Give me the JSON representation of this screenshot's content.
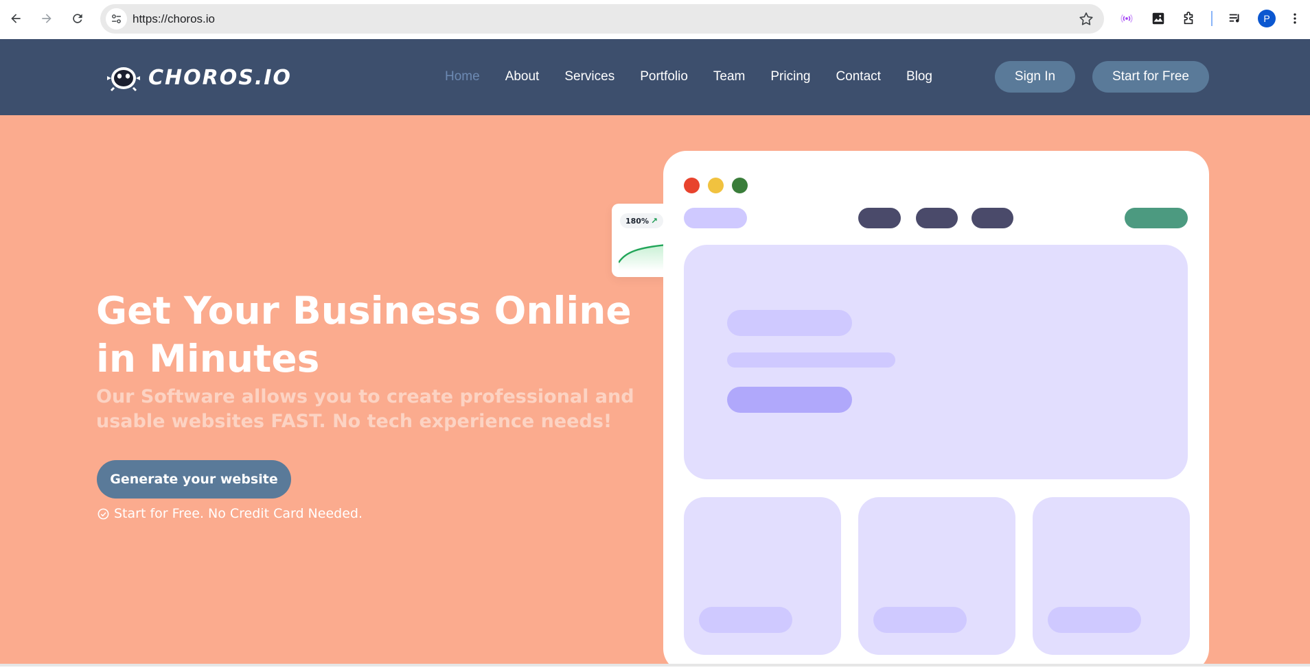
{
  "browser": {
    "url": "https://choros.io",
    "profile_initial": "P",
    "icons": [
      "back-icon",
      "forward-icon",
      "reload-icon",
      "site-settings-icon",
      "bookmark-star-icon",
      "broadcast-icon",
      "image-capture-icon",
      "extensions-puzzle-icon",
      "reading-list-icon",
      "profile-avatar",
      "more-menu-icon"
    ]
  },
  "header": {
    "brand": "CHOROS.IO",
    "nav": [
      "Home",
      "About",
      "Services",
      "Portfolio",
      "Team",
      "Pricing",
      "Contact",
      "Blog"
    ],
    "active_nav": "Home",
    "sign_in": "Sign In",
    "start_free": "Start for Free"
  },
  "hero": {
    "title": "Get Your Business Online in Minutes",
    "subtitle": "Our Software allows you to create professional and usable websites FAST. No tech experience needs!",
    "cta": "Generate your website",
    "note": "Start for Free. No Credit Card Needed."
  },
  "illustration": {
    "stat_badge": "180%",
    "colors": {
      "dot_red": "#e8432d",
      "dot_yellow": "#f1c23f",
      "dot_green": "#3a7d3a",
      "nav_dark": "#4a4a6a",
      "accent_green": "#4c9a80",
      "lavender": "#e2defe",
      "lavender_mid": "#cfc9ff",
      "lavender_deep": "#b0a8fb"
    }
  },
  "colors": {
    "header_bg": "#3d4f6d",
    "hero_bg": "#fbab8e",
    "button_bg": "#5a7a99",
    "active_nav": "#6d8ab3"
  }
}
